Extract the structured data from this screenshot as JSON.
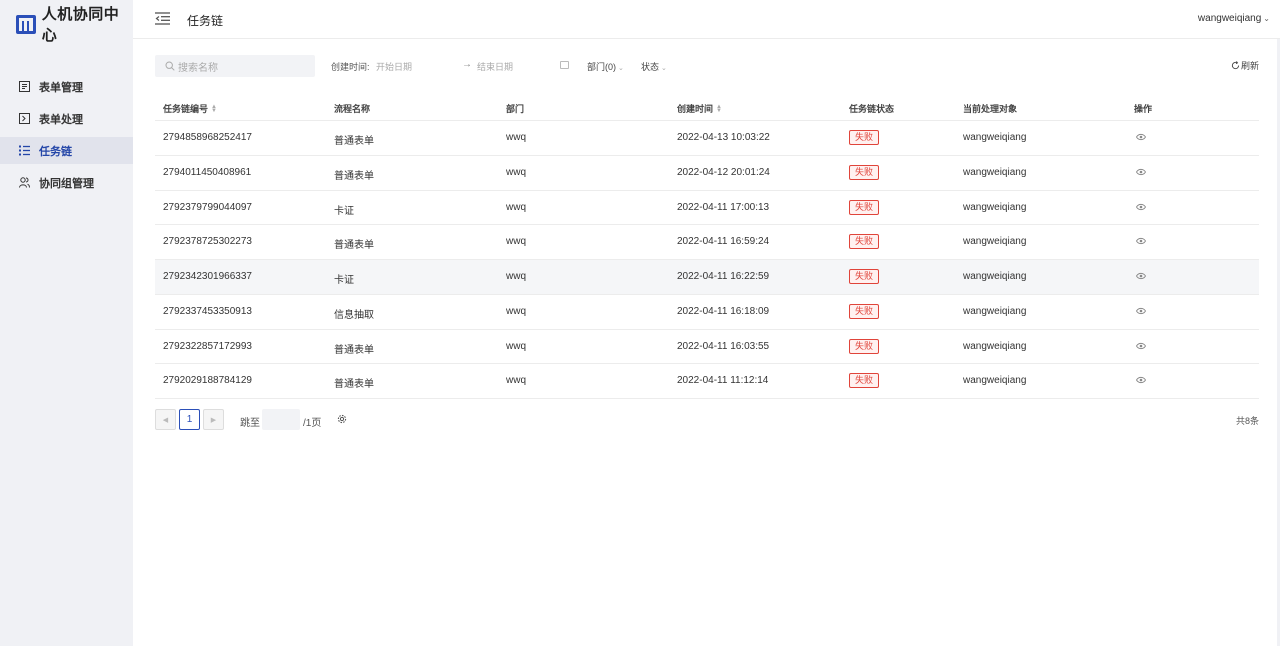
{
  "brand": {
    "name": "人机协同中心"
  },
  "sidebar": {
    "items": [
      {
        "label": "表单管理",
        "icon": "form-list-icon",
        "active": false
      },
      {
        "label": "表单处理",
        "icon": "form-process-icon",
        "active": false
      },
      {
        "label": "任务链",
        "icon": "task-chain-icon",
        "active": true
      },
      {
        "label": "协同组管理",
        "icon": "users-icon",
        "active": false
      }
    ]
  },
  "header": {
    "title": "任务链",
    "user": "wangweiqiang"
  },
  "filters": {
    "search_placeholder": "搜索名称",
    "created_label": "创建时间:",
    "start_placeholder": "开始日期",
    "end_placeholder": "结束日期",
    "dept_label": "部门(0)",
    "status_label": "状态",
    "refresh_label": "刷新"
  },
  "table": {
    "columns": [
      "任务链编号",
      "流程名称",
      "部门",
      "创建时间",
      "任务链状态",
      "当前处理对象",
      "操作"
    ],
    "rows": [
      {
        "id": "2794858968252417",
        "flow": "普通表单",
        "dept": "wwq",
        "created": "2022-04-13 10:03:22",
        "status": "失败",
        "handler": "wangweiqiang"
      },
      {
        "id": "2794011450408961",
        "flow": "普通表单",
        "dept": "wwq",
        "created": "2022-04-12 20:01:24",
        "status": "失败",
        "handler": "wangweiqiang"
      },
      {
        "id": "2792379799044097",
        "flow": "卡证",
        "dept": "wwq",
        "created": "2022-04-11 17:00:13",
        "status": "失败",
        "handler": "wangweiqiang"
      },
      {
        "id": "2792378725302273",
        "flow": "普通表单",
        "dept": "wwq",
        "created": "2022-04-11 16:59:24",
        "status": "失败",
        "handler": "wangweiqiang"
      },
      {
        "id": "2792342301966337",
        "flow": "卡证",
        "dept": "wwq",
        "created": "2022-04-11 16:22:59",
        "status": "失败",
        "handler": "wangweiqiang"
      },
      {
        "id": "2792337453350913",
        "flow": "信息抽取",
        "dept": "wwq",
        "created": "2022-04-11 16:18:09",
        "status": "失败",
        "handler": "wangweiqiang"
      },
      {
        "id": "2792322857172993",
        "flow": "普通表单",
        "dept": "wwq",
        "created": "2022-04-11 16:03:55",
        "status": "失败",
        "handler": "wangweiqiang"
      },
      {
        "id": "2792029188784129",
        "flow": "普通表单",
        "dept": "wwq",
        "created": "2022-04-11 11:12:14",
        "status": "失败",
        "handler": "wangweiqiang"
      }
    ]
  },
  "pagination": {
    "current": "1",
    "jump_label": "跳至",
    "pages_label": "/1页",
    "total_label": "共8条"
  },
  "colors": {
    "accent": "#2b4fb8",
    "fail": "#e0443a",
    "sidebar_bg": "#f0f1f5"
  }
}
